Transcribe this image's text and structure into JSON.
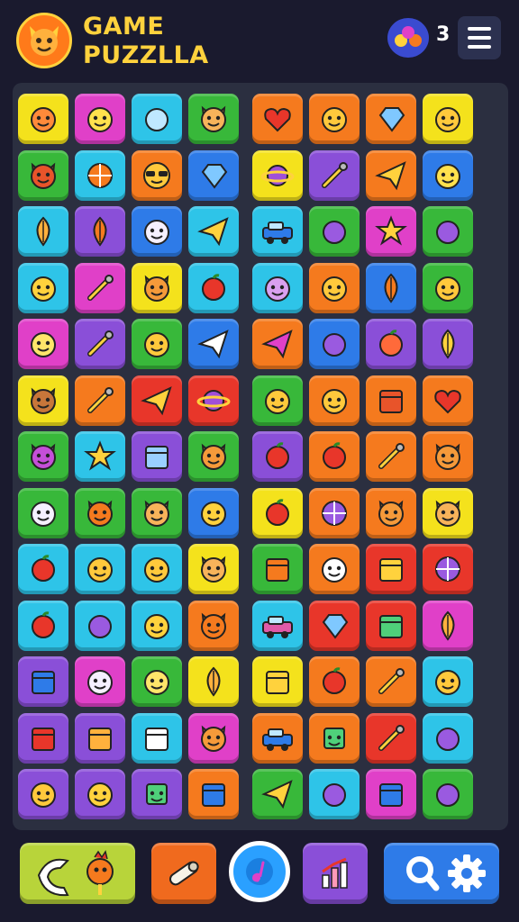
{
  "header": {
    "title_line1": "GAME",
    "title_line2": "PUZZLLA",
    "player_count": "3"
  },
  "colors": {
    "yellow": "#f4e21c",
    "magenta": "#e040c8",
    "cyan": "#2ec4e8",
    "green": "#38b83a",
    "orange": "#f57a1e",
    "purple": "#8a4fd8",
    "blue": "#2e7be8",
    "red": "#e8362a",
    "pink": "#e05aa8"
  },
  "board": {
    "rows": [
      {
        "tiles": [
          {
            "c": "yellow",
            "icon": "crab-icon"
          },
          {
            "c": "magenta",
            "icon": "fish-icon"
          },
          {
            "c": "cyan",
            "icon": "bubble-icon"
          },
          {
            "c": "green",
            "icon": "cat-icon"
          },
          {
            "c": "orange",
            "icon": "heart-icon"
          },
          {
            "c": "orange",
            "icon": "smiley-icon"
          },
          {
            "c": "orange",
            "icon": "gem-icon"
          },
          {
            "c": "yellow",
            "icon": "smiley-icon"
          }
        ]
      },
      {
        "tiles": [
          {
            "c": "green",
            "icon": "bull-icon"
          },
          {
            "c": "cyan",
            "icon": "gear-icon"
          },
          {
            "c": "orange",
            "icon": "sunglasses-icon"
          },
          {
            "c": "blue",
            "icon": "crystal-icon"
          },
          {
            "c": "yellow",
            "icon": "planet-icon"
          },
          {
            "c": "purple",
            "icon": "wand-icon"
          },
          {
            "c": "orange",
            "icon": "plane-icon"
          },
          {
            "c": "blue",
            "icon": "duck-icon"
          }
        ]
      },
      {
        "tiles": [
          {
            "c": "cyan",
            "icon": "leaf-icon"
          },
          {
            "c": "purple",
            "icon": "carrot-icon"
          },
          {
            "c": "blue",
            "icon": "ghost-icon"
          },
          {
            "c": "cyan",
            "icon": "paper-plane-icon"
          },
          {
            "c": "cyan",
            "icon": "car-icon"
          },
          {
            "c": "green",
            "icon": "ball-icon"
          },
          {
            "c": "magenta",
            "icon": "star-icon"
          },
          {
            "c": "green",
            "icon": "ball-icon"
          }
        ]
      },
      {
        "tiles": [
          {
            "c": "cyan",
            "icon": "chick-icon"
          },
          {
            "c": "magenta",
            "icon": "hammer-icon"
          },
          {
            "c": "yellow",
            "icon": "bear-icon"
          },
          {
            "c": "cyan",
            "icon": "apple-icon"
          },
          {
            "c": "cyan",
            "icon": "monkey-icon"
          },
          {
            "c": "orange",
            "icon": "smiley-icon"
          },
          {
            "c": "blue",
            "icon": "carrot-icon"
          },
          {
            "c": "green",
            "icon": "smiley-icon"
          }
        ]
      },
      {
        "tiles": [
          {
            "c": "magenta",
            "icon": "egg-icon"
          },
          {
            "c": "purple",
            "icon": "wand-icon"
          },
          {
            "c": "green",
            "icon": "smiley-icon"
          },
          {
            "c": "blue",
            "icon": "bird-icon"
          },
          {
            "c": "orange",
            "icon": "rocket-icon"
          },
          {
            "c": "blue",
            "icon": "ball-icon"
          },
          {
            "c": "purple",
            "icon": "cherry-icon"
          },
          {
            "c": "purple",
            "icon": "cone-icon"
          }
        ]
      },
      {
        "tiles": [
          {
            "c": "yellow",
            "icon": "owl-icon"
          },
          {
            "c": "orange",
            "icon": "brush-icon"
          },
          {
            "c": "red",
            "icon": "paper-plane-icon"
          },
          {
            "c": "red",
            "icon": "planet-icon"
          },
          {
            "c": "green",
            "icon": "smiley-icon"
          },
          {
            "c": "orange",
            "icon": "smiley-icon"
          },
          {
            "c": "orange",
            "icon": "cracker-icon"
          },
          {
            "c": "orange",
            "icon": "heart-icon"
          }
        ]
      },
      {
        "tiles": [
          {
            "c": "green",
            "icon": "devil-icon"
          },
          {
            "c": "cyan",
            "icon": "star-icon"
          },
          {
            "c": "purple",
            "icon": "book-icon"
          },
          {
            "c": "green",
            "icon": "bear-icon"
          },
          {
            "c": "purple",
            "icon": "apple-icon"
          },
          {
            "c": "orange",
            "icon": "apple-icon"
          },
          {
            "c": "orange",
            "icon": "pen-icon"
          },
          {
            "c": "orange",
            "icon": "bear-icon"
          }
        ]
      },
      {
        "tiles": [
          {
            "c": "green",
            "icon": "ghost-icon"
          },
          {
            "c": "green",
            "icon": "fox-icon"
          },
          {
            "c": "green",
            "icon": "cat-icon"
          },
          {
            "c": "blue",
            "icon": "chick-icon"
          },
          {
            "c": "yellow",
            "icon": "apple-icon"
          },
          {
            "c": "orange",
            "icon": "wheel-icon"
          },
          {
            "c": "orange",
            "icon": "bear-icon"
          },
          {
            "c": "yellow",
            "icon": "cat-icon"
          }
        ]
      },
      {
        "tiles": [
          {
            "c": "cyan",
            "icon": "apple-icon"
          },
          {
            "c": "cyan",
            "icon": "smiley-icon"
          },
          {
            "c": "cyan",
            "icon": "smiley-icon"
          },
          {
            "c": "yellow",
            "icon": "cat-icon"
          },
          {
            "c": "green",
            "icon": "building-icon"
          },
          {
            "c": "orange",
            "icon": "sun-icon"
          },
          {
            "c": "red",
            "icon": "frame-icon"
          },
          {
            "c": "red",
            "icon": "wheel-icon"
          }
        ]
      },
      {
        "tiles": [
          {
            "c": "cyan",
            "icon": "apple-icon"
          },
          {
            "c": "cyan",
            "icon": "ball-icon"
          },
          {
            "c": "cyan",
            "icon": "chick-icon"
          },
          {
            "c": "orange",
            "icon": "fox-icon"
          },
          {
            "c": "cyan",
            "icon": "truck-icon"
          },
          {
            "c": "red",
            "icon": "gem-icon"
          },
          {
            "c": "red",
            "icon": "chart-icon"
          },
          {
            "c": "magenta",
            "icon": "leaf-icon"
          }
        ]
      },
      {
        "tiles": [
          {
            "c": "purple",
            "icon": "dice-icon"
          },
          {
            "c": "magenta",
            "icon": "ghost-icon"
          },
          {
            "c": "green",
            "icon": "egg-icon"
          },
          {
            "c": "yellow",
            "icon": "leaf-icon"
          },
          {
            "c": "yellow",
            "icon": "briefcase-icon"
          },
          {
            "c": "orange",
            "icon": "apple-icon"
          },
          {
            "c": "orange",
            "icon": "hammer-icon"
          },
          {
            "c": "cyan",
            "icon": "smiley-icon"
          }
        ]
      },
      {
        "tiles": [
          {
            "c": "purple",
            "icon": "jar-icon"
          },
          {
            "c": "purple",
            "icon": "box-icon"
          },
          {
            "c": "cyan",
            "icon": "screen-icon"
          },
          {
            "c": "magenta",
            "icon": "bear-icon"
          },
          {
            "c": "orange",
            "icon": "car-icon"
          },
          {
            "c": "orange",
            "icon": "robot-icon"
          },
          {
            "c": "red",
            "icon": "magnifier-icon"
          },
          {
            "c": "cyan",
            "icon": "ball-icon"
          }
        ]
      },
      {
        "tiles": [
          {
            "c": "purple",
            "icon": "smiley-icon"
          },
          {
            "c": "purple",
            "icon": "chick-icon"
          },
          {
            "c": "purple",
            "icon": "robot-icon"
          },
          {
            "c": "orange",
            "icon": "tray-icon"
          },
          {
            "c": "green",
            "icon": "paper-plane-icon"
          },
          {
            "c": "cyan",
            "icon": "ball-icon"
          },
          {
            "c": "magenta",
            "icon": "bag-icon"
          },
          {
            "c": "green",
            "icon": "ball-icon"
          }
        ]
      }
    ]
  },
  "bottom_bar": {
    "buttons": [
      {
        "name": "hint-button",
        "color": "#b8d43a",
        "icons": [
          "boomerang-icon",
          "rooster-icon"
        ]
      },
      {
        "name": "scroll-button",
        "color": "#f06a1e",
        "icons": [
          "scroll-icon"
        ]
      },
      {
        "name": "play-button",
        "color": "#2aa0ff",
        "icons": [
          "music-note-icon"
        ]
      },
      {
        "name": "stats-button",
        "color": "#8a4fd8",
        "icons": [
          "chart-icon"
        ]
      },
      {
        "name": "search-settings-button",
        "color": "#2e7be8",
        "icons": [
          "search-icon",
          "gear-icon"
        ]
      }
    ]
  }
}
